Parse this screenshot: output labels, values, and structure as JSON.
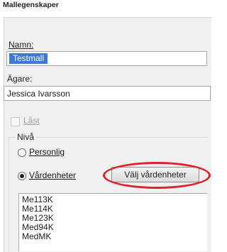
{
  "window": {
    "title": "Mallegenskaper"
  },
  "form": {
    "name_label": "Namn:",
    "name_value": "Testmall",
    "owner_label": "Ägare:",
    "owner_value": "Jessica Ivarsson",
    "locked_label": "Låst",
    "locked_checked": false,
    "level_group_label": "Nivå",
    "radio_personal_label": "Personlig",
    "radio_care_units_label": "Vårdenheter",
    "selected_level": "Vårdenheter",
    "choose_units_button": "Välj vårdenheter"
  },
  "care_units": [
    "Me113K",
    "Me114K",
    "Me123K",
    "Med94K",
    "MedMK"
  ],
  "annotation": {
    "highlight_color": "#e0212a"
  }
}
